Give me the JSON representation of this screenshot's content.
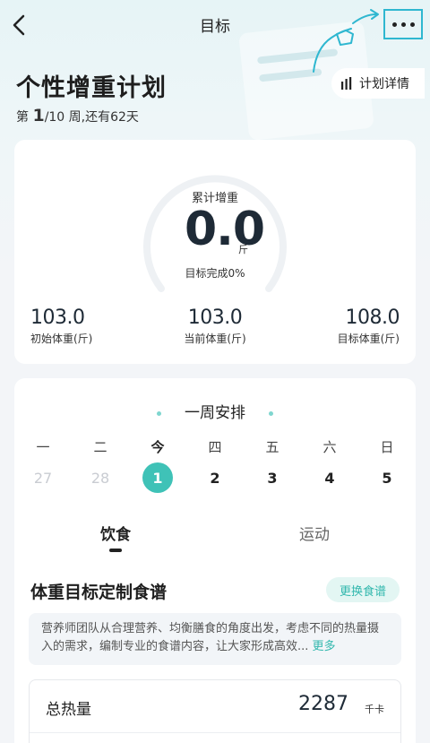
{
  "nav": {
    "title": "目标"
  },
  "plan": {
    "title": "个性增重计划",
    "week_prefix": "第",
    "week_current": "1",
    "week_rest": "/10 周,还有62天",
    "detail_button": "计划详情"
  },
  "progress": {
    "cumulative_label": "累计增重",
    "cumulative_value": "0.0",
    "unit": "斤",
    "completion_text": "目标完成0%",
    "completion_fraction": 0.0,
    "stats": [
      {
        "value": "103.0",
        "label": "初始体重(斤)"
      },
      {
        "value": "103.0",
        "label": "当前体重(斤)"
      },
      {
        "value": "108.0",
        "label": "目标体重(斤)"
      }
    ]
  },
  "week": {
    "title": "一周安排",
    "days": [
      "一",
      "二",
      "今",
      "四",
      "五",
      "六",
      "日"
    ],
    "dates": [
      "27",
      "28",
      "1",
      "2",
      "3",
      "4",
      "5"
    ],
    "selected_index": 2
  },
  "tabs": {
    "diet": "饮食",
    "sport": "运动"
  },
  "recipe": {
    "title": "体重目标定制食谱",
    "swap_button": "更换食谱",
    "description": "营养师团队从合理营养、均衡膳食的角度出发，考虑不同的热量摄入的需求，编制专业的食谱内容，让大家形成高效...",
    "more_link": "更多",
    "calories_label": "总热量",
    "calories_value": "2287",
    "calories_unit": "千卡"
  },
  "colors": {
    "accent": "#3fc2b7",
    "annotation": "#2fb7d0"
  },
  "icons": [
    "back-icon",
    "more-icon",
    "bar-chart-icon"
  ]
}
